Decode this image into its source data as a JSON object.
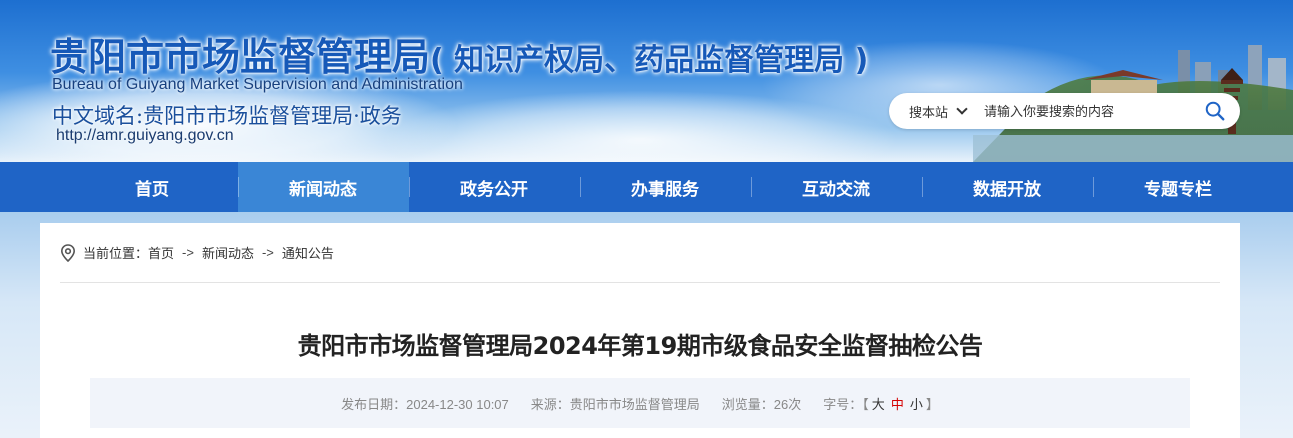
{
  "header": {
    "title_cn": "贵阳市市场监督管理局",
    "title_paren": "( 知识产权局、药品监督管理局 )",
    "title_en": "Bureau of Guiyang Market Supervision and Administration",
    "domain_cn": "中文域名:贵阳市市场监督管理局·政务",
    "domain_url": "http://amr.guiyang.gov.cn"
  },
  "search": {
    "scope": "搜本站",
    "placeholder": "请输入你要搜索的内容",
    "button_icon": "search-icon"
  },
  "nav": {
    "items": [
      {
        "label": "首页"
      },
      {
        "label": "新闻动态",
        "active": true
      },
      {
        "label": "政务公开"
      },
      {
        "label": "办事服务"
      },
      {
        "label": "互动交流"
      },
      {
        "label": "数据开放"
      },
      {
        "label": "专题专栏"
      }
    ]
  },
  "breadcrumb": {
    "icon": "location-pin-icon",
    "prefix": "当前位置：",
    "items": [
      "首页",
      "新闻动态",
      "通知公告"
    ],
    "separator": "->"
  },
  "article": {
    "title": "贵阳市市场监督管理局2024年第19期市级食品安全监督抽检公告",
    "publish_date": "发布日期：2024-12-30 10:07",
    "source": "来源：贵阳市市场监督管理局",
    "views": "浏览量：26次",
    "font_size_label": "字号：",
    "font_sizes": [
      "大",
      "中",
      "小"
    ],
    "font_size_open": "【",
    "font_size_close": "】"
  },
  "colors": {
    "nav_bg": "#1f64c6",
    "nav_active": "#3a86d6",
    "title_blue": "#1659b8",
    "font_size_active": "#d40000"
  }
}
